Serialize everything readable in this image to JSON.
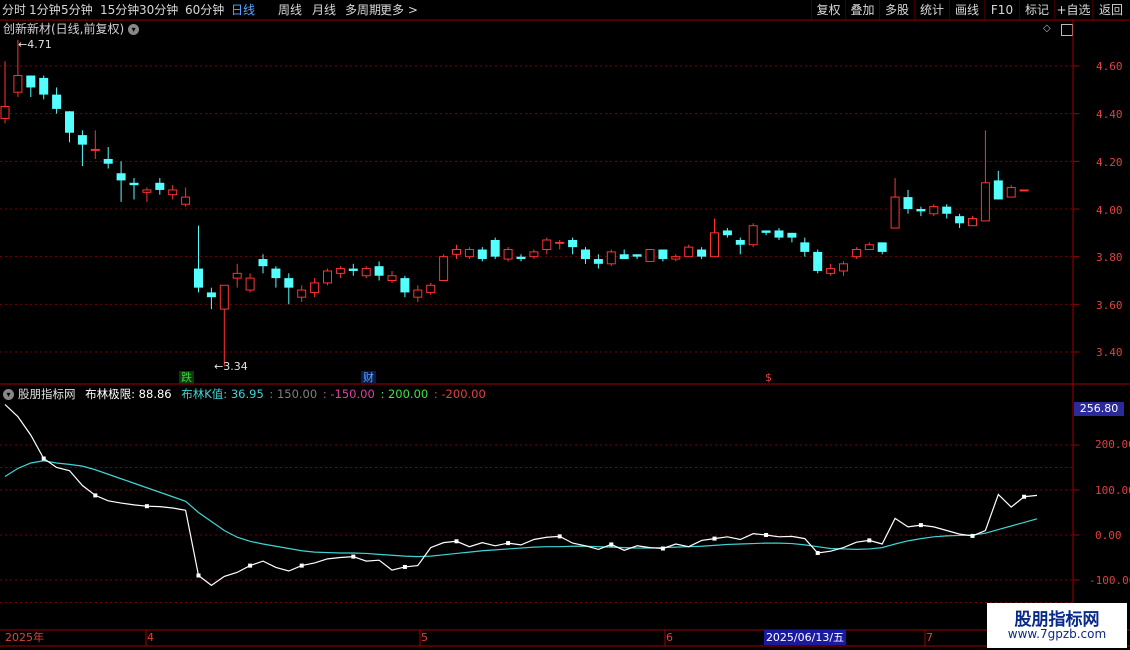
{
  "toolbar": {
    "left": [
      {
        "label": "分时"
      },
      {
        "label": "1分钟"
      },
      {
        "label": "5分钟"
      },
      {
        "label": "15分钟"
      },
      {
        "label": "30分钟"
      },
      {
        "label": "60分钟"
      },
      {
        "label": "日线",
        "active": true
      },
      {
        "label": "周线"
      },
      {
        "label": "月线"
      },
      {
        "label": "多周期"
      },
      {
        "label": "更多 >"
      }
    ],
    "right": [
      {
        "label": "复权"
      },
      {
        "label": "叠加"
      },
      {
        "label": "多股"
      },
      {
        "label": "统计"
      },
      {
        "label": "画线"
      },
      {
        "label": "F10"
      },
      {
        "label": "标记"
      },
      {
        "label": "+自选"
      },
      {
        "label": "返回"
      }
    ]
  },
  "main_title": "创新新材(日线,前复权)",
  "price_axis": [
    "4.60",
    "4.40",
    "4.20",
    "4.00",
    "3.80",
    "3.60",
    "3.40"
  ],
  "high_label": "4.71",
  "low_label": "3.34",
  "event_tags": [
    {
      "text": "跌",
      "color": "#40d040"
    },
    {
      "text": "财",
      "color": "#58a8ff"
    },
    {
      "text": "$",
      "color": "#e04040"
    }
  ],
  "indicator": {
    "name": "股朋指标网",
    "line1": "布林极限: 88.86",
    "line2": "布林K值: 36.95",
    "p150": ": 150.00",
    "m150": ": -150.00",
    "p200": ": 200.00",
    "m200": ": -200.00",
    "axis": [
      "200.00",
      "100.00",
      "0.00",
      "-100.00"
    ],
    "current": "256.80"
  },
  "dates": [
    "2025年",
    "4",
    "5",
    "6",
    "7"
  ],
  "cursor_date": "2025/06/13/五",
  "watermark": {
    "line1": "股朋指标网",
    "line2": "www.7gpzb.com"
  },
  "colors": {
    "up": "#ff3232",
    "down": "#54ffff",
    "line_white": "#ffffff",
    "line_cyan": "#3fd4d4",
    "grid": "#7a0000"
  },
  "chart_data": {
    "type": "candlestick",
    "ylim": [
      3.3,
      4.75
    ],
    "candles": [
      [
        4.38,
        4.43,
        4.62,
        4.36
      ],
      [
        4.49,
        4.56,
        4.71,
        4.47
      ],
      [
        4.56,
        4.51,
        4.56,
        4.47
      ],
      [
        4.55,
        4.48,
        4.56,
        4.46
      ],
      [
        4.48,
        4.42,
        4.51,
        4.4
      ],
      [
        4.41,
        4.32,
        4.41,
        4.28
      ],
      [
        4.31,
        4.27,
        4.33,
        4.18
      ],
      [
        4.25,
        4.25,
        4.33,
        4.21
      ],
      [
        4.21,
        4.19,
        4.26,
        4.17
      ],
      [
        4.15,
        4.12,
        4.2,
        4.03
      ],
      [
        4.11,
        4.1,
        4.13,
        4.04
      ],
      [
        4.07,
        4.08,
        4.09,
        4.03
      ],
      [
        4.11,
        4.08,
        4.13,
        4.06
      ],
      [
        4.06,
        4.08,
        4.1,
        4.04
      ],
      [
        4.02,
        4.05,
        4.09,
        4.01
      ],
      [
        3.75,
        3.67,
        3.93,
        3.65
      ],
      [
        3.65,
        3.63,
        3.67,
        3.58
      ],
      [
        3.58,
        3.68,
        3.68,
        3.34
      ],
      [
        3.71,
        3.73,
        3.77,
        3.67
      ],
      [
        3.66,
        3.71,
        3.73,
        3.65
      ],
      [
        3.79,
        3.76,
        3.81,
        3.73
      ],
      [
        3.75,
        3.71,
        3.76,
        3.67
      ],
      [
        3.71,
        3.67,
        3.73,
        3.6
      ],
      [
        3.63,
        3.66,
        3.68,
        3.61
      ],
      [
        3.65,
        3.69,
        3.71,
        3.63
      ],
      [
        3.69,
        3.74,
        3.75,
        3.68
      ],
      [
        3.73,
        3.75,
        3.76,
        3.71
      ],
      [
        3.75,
        3.74,
        3.77,
        3.72
      ],
      [
        3.72,
        3.75,
        3.76,
        3.71
      ],
      [
        3.76,
        3.72,
        3.78,
        3.7
      ],
      [
        3.7,
        3.72,
        3.74,
        3.69
      ],
      [
        3.71,
        3.65,
        3.72,
        3.63
      ],
      [
        3.63,
        3.66,
        3.68,
        3.61
      ],
      [
        3.65,
        3.68,
        3.69,
        3.64
      ],
      [
        3.7,
        3.8,
        3.81,
        3.7
      ],
      [
        3.81,
        3.83,
        3.85,
        3.79
      ],
      [
        3.8,
        3.83,
        3.84,
        3.79
      ],
      [
        3.83,
        3.79,
        3.84,
        3.78
      ],
      [
        3.87,
        3.8,
        3.88,
        3.79
      ],
      [
        3.79,
        3.83,
        3.84,
        3.78
      ],
      [
        3.8,
        3.79,
        3.81,
        3.78
      ],
      [
        3.8,
        3.82,
        3.83,
        3.79
      ],
      [
        3.83,
        3.87,
        3.88,
        3.81
      ],
      [
        3.86,
        3.86,
        3.87,
        3.83
      ],
      [
        3.87,
        3.84,
        3.88,
        3.81
      ],
      [
        3.83,
        3.79,
        3.84,
        3.77
      ],
      [
        3.79,
        3.77,
        3.81,
        3.75
      ],
      [
        3.77,
        3.82,
        3.83,
        3.76
      ],
      [
        3.81,
        3.79,
        3.83,
        3.79
      ],
      [
        3.81,
        3.8,
        3.81,
        3.79
      ],
      [
        3.78,
        3.83,
        3.83,
        3.78
      ],
      [
        3.83,
        3.79,
        3.83,
        3.78
      ],
      [
        3.79,
        3.8,
        3.81,
        3.78
      ],
      [
        3.8,
        3.84,
        3.85,
        3.8
      ],
      [
        3.83,
        3.8,
        3.84,
        3.79
      ],
      [
        3.8,
        3.9,
        3.96,
        3.8
      ],
      [
        3.91,
        3.89,
        3.92,
        3.88
      ],
      [
        3.87,
        3.85,
        3.88,
        3.81
      ],
      [
        3.85,
        3.93,
        3.94,
        3.84
      ],
      [
        3.91,
        3.9,
        3.91,
        3.89
      ],
      [
        3.91,
        3.88,
        3.92,
        3.87
      ],
      [
        3.9,
        3.88,
        3.9,
        3.86
      ],
      [
        3.86,
        3.82,
        3.88,
        3.8
      ],
      [
        3.82,
        3.74,
        3.83,
        3.73
      ],
      [
        3.73,
        3.75,
        3.77,
        3.72
      ],
      [
        3.74,
        3.77,
        3.78,
        3.72
      ],
      [
        3.8,
        3.83,
        3.84,
        3.79
      ],
      [
        3.83,
        3.85,
        3.86,
        3.83
      ],
      [
        3.86,
        3.82,
        3.86,
        3.81
      ],
      [
        3.92,
        4.05,
        4.13,
        3.92
      ],
      [
        4.05,
        4.0,
        4.08,
        3.98
      ],
      [
        4.0,
        3.99,
        4.01,
        3.97
      ],
      [
        3.98,
        4.01,
        4.02,
        3.97
      ],
      [
        4.01,
        3.98,
        4.02,
        3.96
      ],
      [
        3.97,
        3.94,
        3.98,
        3.92
      ],
      [
        3.93,
        3.96,
        3.97,
        3.93
      ],
      [
        3.95,
        4.11,
        4.33,
        3.95
      ],
      [
        4.12,
        4.04,
        4.16,
        4.04
      ],
      [
        4.05,
        4.09,
        4.1,
        4.05
      ],
      [
        4.08,
        4.08,
        4.08,
        4.08
      ]
    ],
    "white_line": [
      290,
      263,
      222,
      170,
      150,
      143,
      110,
      88,
      76,
      71,
      67,
      64,
      63,
      60,
      55,
      -90,
      -112,
      -92,
      -83,
      -68,
      -58,
      -72,
      -80,
      -68,
      -62,
      -53,
      -50,
      -48,
      -58,
      -56,
      -78,
      -71,
      -68,
      -28,
      -17,
      -14,
      -26,
      -17,
      -24,
      -18,
      -22,
      -10,
      -5,
      -3,
      -18,
      -24,
      -32,
      -21,
      -34,
      -24,
      -28,
      -30,
      -20,
      -26,
      -12,
      -8,
      -4,
      -10,
      3,
      0,
      -4,
      -3,
      -8,
      -40,
      -36,
      -28,
      -16,
      -12,
      -20,
      37,
      18,
      22,
      18,
      10,
      2,
      -2,
      10,
      90,
      62,
      85,
      88
    ],
    "cyan_line": [
      130,
      148,
      160,
      165,
      160,
      157,
      153,
      145,
      135,
      125,
      115,
      105,
      95,
      85,
      75,
      50,
      30,
      10,
      -5,
      -14,
      -20,
      -25,
      -30,
      -35,
      -38,
      -39,
      -40,
      -40,
      -41,
      -43,
      -45,
      -47,
      -48,
      -47,
      -44,
      -41,
      -38,
      -35,
      -33,
      -31,
      -29,
      -27,
      -26,
      -26,
      -25,
      -25,
      -26,
      -27,
      -28,
      -29,
      -29,
      -28,
      -27,
      -26,
      -25,
      -23,
      -21,
      -20,
      -19,
      -18,
      -18,
      -19,
      -22,
      -26,
      -30,
      -31,
      -32,
      -31,
      -28,
      -20,
      -13,
      -8,
      -4,
      -2,
      -1,
      0,
      4,
      12,
      20,
      28,
      36
    ]
  }
}
